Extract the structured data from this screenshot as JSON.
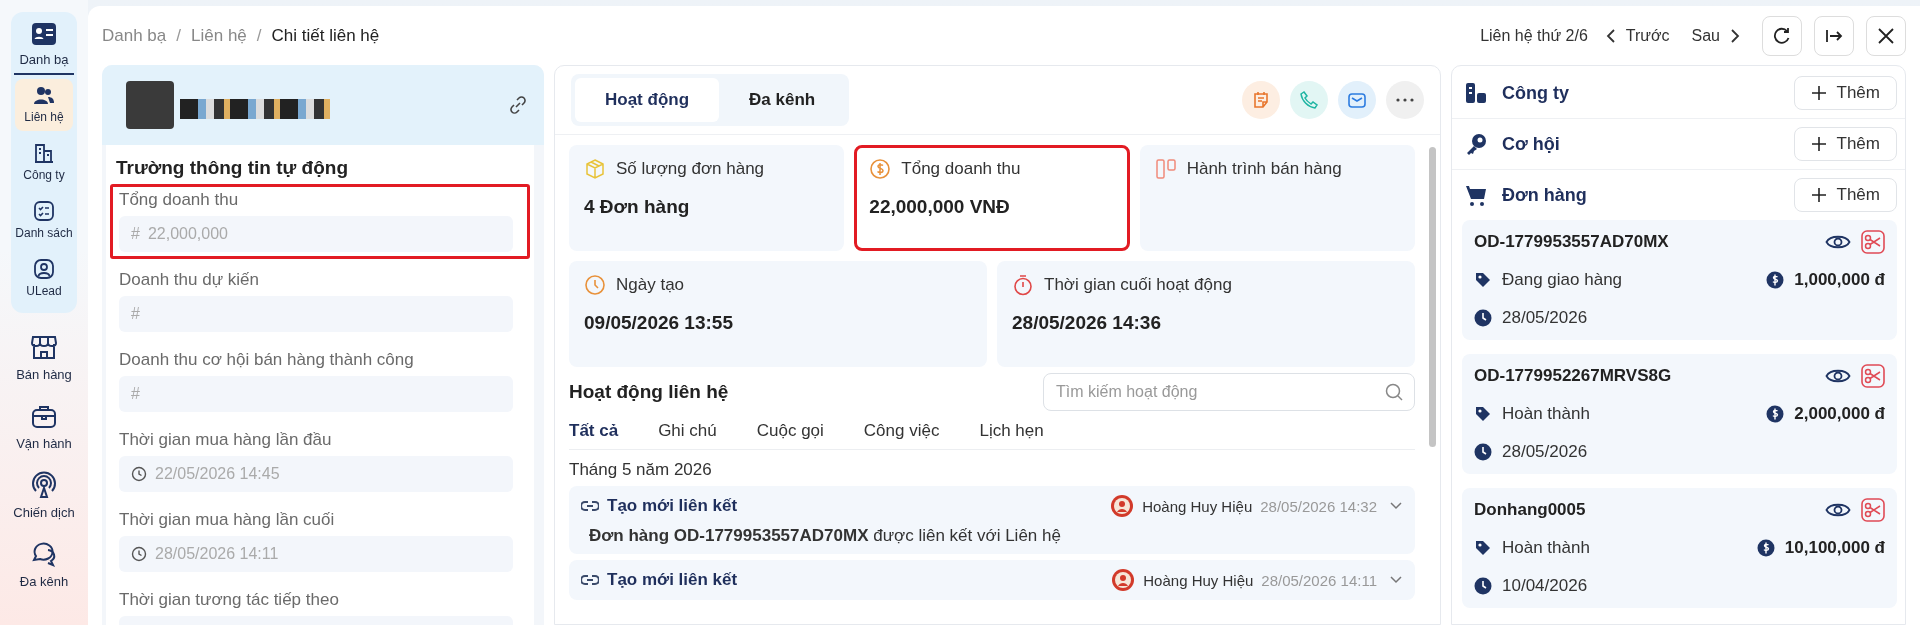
{
  "sidebar": {
    "module": {
      "label": "Danh bạ",
      "selected": true
    },
    "sub_items": [
      {
        "label": "Liên hệ",
        "selected": true
      },
      {
        "label": "Công ty",
        "selected": false
      },
      {
        "label": "Danh sách",
        "selected": false
      },
      {
        "label": "ULead",
        "selected": false
      }
    ],
    "items": [
      {
        "label": "Bán hàng"
      },
      {
        "label": "Vận hành"
      },
      {
        "label": "Chiến dịch"
      },
      {
        "label": "Đa kênh"
      }
    ]
  },
  "breadcrumb": {
    "separator": "/",
    "items": [
      "Danh bạ",
      "Liên hệ",
      "Chi tiết liên hệ"
    ]
  },
  "record_nav": {
    "position": "Liên hệ thứ 2/6",
    "previous": "Trước",
    "next": "Sau"
  },
  "left_panel": {
    "section_title": "Trường thông tin tự động",
    "fields": [
      {
        "label": "Tổng doanh thu",
        "kind": "number",
        "prefix": "#",
        "value": "22,000,000",
        "highlighted": true
      },
      {
        "label": "Doanh thu dự kiến",
        "kind": "number",
        "prefix": "#",
        "highlighted": false
      },
      {
        "label": "Doanh thu cơ hội bán hàng thành công",
        "kind": "number",
        "prefix": "#",
        "highlighted": false
      },
      {
        "label": "Thời gian mua hàng lần đầu",
        "kind": "datetime",
        "value": "22/05/2026 14:45",
        "highlighted": false
      },
      {
        "label": "Thời gian mua hàng lần cuối",
        "kind": "datetime",
        "value": "28/05/2026 14:11",
        "highlighted": false
      },
      {
        "label": "Thời gian tương tác tiếp theo",
        "kind": "datetime",
        "highlighted": false
      }
    ]
  },
  "middle_panel": {
    "tabs": [
      {
        "label": "Hoạt động",
        "selected": true
      },
      {
        "label": "Đa kênh",
        "selected": false
      }
    ],
    "stats": [
      {
        "label": "Số lượng đơn hàng",
        "value": "4 Đơn hàng",
        "highlighted": false
      },
      {
        "label": "Tổng doanh thu",
        "value": "22,000,000 VNĐ",
        "highlighted": true
      },
      {
        "label": "Hành trình bán hàng",
        "highlighted": false
      },
      {
        "label": "Ngày tạo",
        "value": "09/05/2026 13:55",
        "highlighted": false
      },
      {
        "label": "Thời gian cuối hoạt động",
        "value": "28/05/2026 14:36",
        "highlighted": false
      }
    ],
    "activity": {
      "title": "Hoạt động liên hệ",
      "search": {
        "placeholder": "Tìm kiếm hoạt động"
      },
      "filters": [
        {
          "label": "Tất cả",
          "selected": true
        },
        {
          "label": "Ghi chú",
          "selected": false
        },
        {
          "label": "Cuộc gọi",
          "selected": false
        },
        {
          "label": "Công việc",
          "selected": false
        },
        {
          "label": "Lịch hẹn",
          "selected": false
        }
      ],
      "month": "Tháng 5 năm 2026",
      "items": [
        {
          "title": "Tạo mới liên kết",
          "user": "Hoàng Huy Hiệu",
          "time": "28/05/2026 14:32",
          "body": "**Đơn hàng OD-1779953557AD70MX** được liên kết với Liên hệ"
        },
        {
          "title": "Tạo mới liên kết",
          "user": "Hoàng Huy Hiệu",
          "time": "28/05/2026 14:11"
        }
      ]
    }
  },
  "right_panel": {
    "sections": [
      {
        "title": "Công ty",
        "button": "Thêm"
      },
      {
        "title": "Cơ hội",
        "button": "Thêm"
      },
      {
        "title": "Đơn hàng",
        "button": "Thêm"
      }
    ],
    "orders": [
      {
        "code": "OD-1779953557AD70MX",
        "status": "Đang giao hàng",
        "amount": "1,000,000 đ",
        "date": "28/05/2026"
      },
      {
        "code": "OD-1779952267MRVS8G",
        "status": "Hoàn thành",
        "amount": "2,000,000 đ",
        "date": "28/05/2026"
      },
      {
        "code": "Donhang0005",
        "status": "Hoàn thành",
        "amount": "10,100,000 đ",
        "date": "10/04/2026"
      }
    ]
  }
}
